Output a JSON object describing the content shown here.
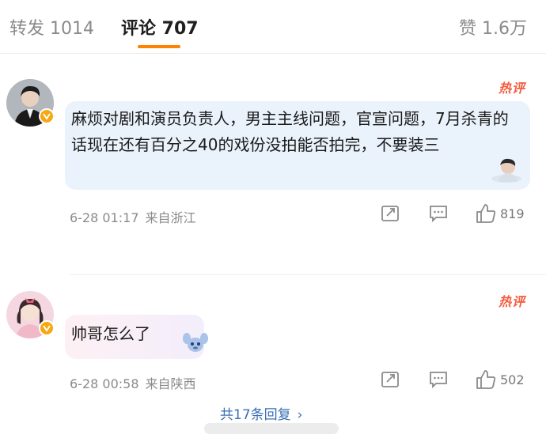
{
  "tabs": {
    "repost": "转发 1014",
    "comments": "评论 707",
    "likes": "赞 1.6万"
  },
  "colors": {
    "accent": "#ff8200",
    "link": "#3b6fb3",
    "hot": "#f45c3f",
    "bubble1": "#eaf2fb"
  },
  "comments": [
    {
      "avatar": "avatar-man-in-suit",
      "badge": "hot-comment-badge",
      "hot_label": "热评",
      "text": "麻烦对剧和演员负责人，男主主线问题，官宣问题，7月杀青的话现在还有百分之40的戏份没拍能否拍完，不要装三",
      "date": "6-28 01:17",
      "source": "来自浙江",
      "likes": "819"
    },
    {
      "avatar": "avatar-girl-with-bow",
      "badge": "hot-comment-badge",
      "hot_label": "热评",
      "text": "帅哥怎么了",
      "date": "6-28 00:58",
      "source": "来自陕西",
      "likes": "502",
      "more_replies": "共17条回复"
    }
  ],
  "icons": {
    "share": "share-icon",
    "reply": "comment-icon",
    "like": "thumbs-up-icon",
    "verified": "verified-badge-icon",
    "chevron": "chevron-right-icon"
  }
}
